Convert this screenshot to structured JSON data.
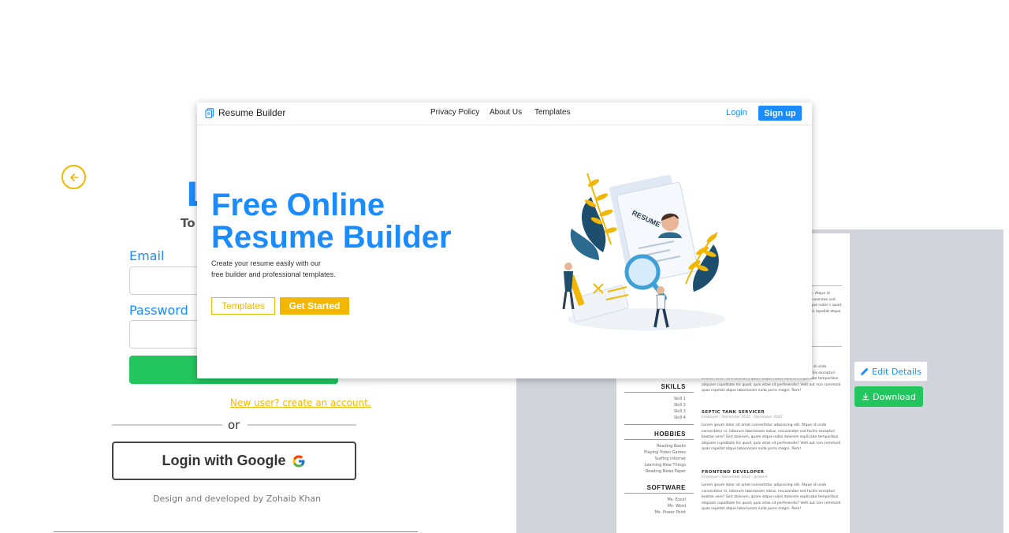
{
  "login": {
    "heading": "L",
    "subheading": "To",
    "email_label": "Email",
    "password_label": "Password",
    "new_user_link": "New user? create an account.",
    "or_text": "or",
    "google_button": "Login with Google",
    "credit": "Design and developed by Zohaib Khan"
  },
  "colors": {
    "primary": "#1a8cff",
    "accent": "#f2b705",
    "success": "#22c55e"
  },
  "icons": {
    "back": "arrow-left-circle-icon",
    "google": "google-logo-icon",
    "brand": "document-icon",
    "edit": "pencil-icon",
    "download": "download-icon"
  },
  "landing": {
    "brand": "Resume Builder",
    "nav": [
      "Privacy Policy",
      "About Us",
      "Templates"
    ],
    "login": "Login",
    "signup": "Sign up",
    "hero_line1": "Free Online",
    "hero_line2": "Resume Builder",
    "desc_line1": "Create your resume easily with our",
    "desc_line2": "free builder and professional templates.",
    "btn_templates": "Templates",
    "btn_started": "Get Started",
    "illustration_label": "RESUME"
  },
  "editor": {
    "edit_details": "Edit Details",
    "download": "Download",
    "sections": {
      "skills": "SKILLS",
      "hobbies": "HOBBIES",
      "software": "SOFTWARE"
    },
    "skills": [
      "Skill 1",
      "Skill 2",
      "Skill 3",
      "Skill 4"
    ],
    "hobbies": [
      "Reading Books",
      "Playing Video Games",
      "Surfing Internet",
      "Learning New Things",
      "Reading News Paper"
    ],
    "software": [
      "Ms- Excel",
      "Ms- Word",
      "Ms- Power Point"
    ],
    "jobs": [
      {
        "title": "SEPTIC TANK SERVICER",
        "sub": "Employer / December 2022 - December 2022"
      },
      {
        "title": "FRONTEND DEVELOPER",
        "sub": "Employer / December 2022 - present"
      }
    ],
    "lorem": "Lorem ipsum dolor sit amet consectetur adipisicing elit. Atque id unde consectetur in, laborum laboriosam natus, recusandae sed facilis excepturi beatae vero? Sint dolorum, quam atque nobis dolorem explicabo temporibus aliquam cupiditate hic quod, quis vitae sit perferendis? Velit aut non commodi quas repellat atque laboriosam nulla porro magni. Rem!",
    "lorem_fragment": "elit. Atque id recusandae sed atque nobis c quod, quis repellat atque"
  }
}
